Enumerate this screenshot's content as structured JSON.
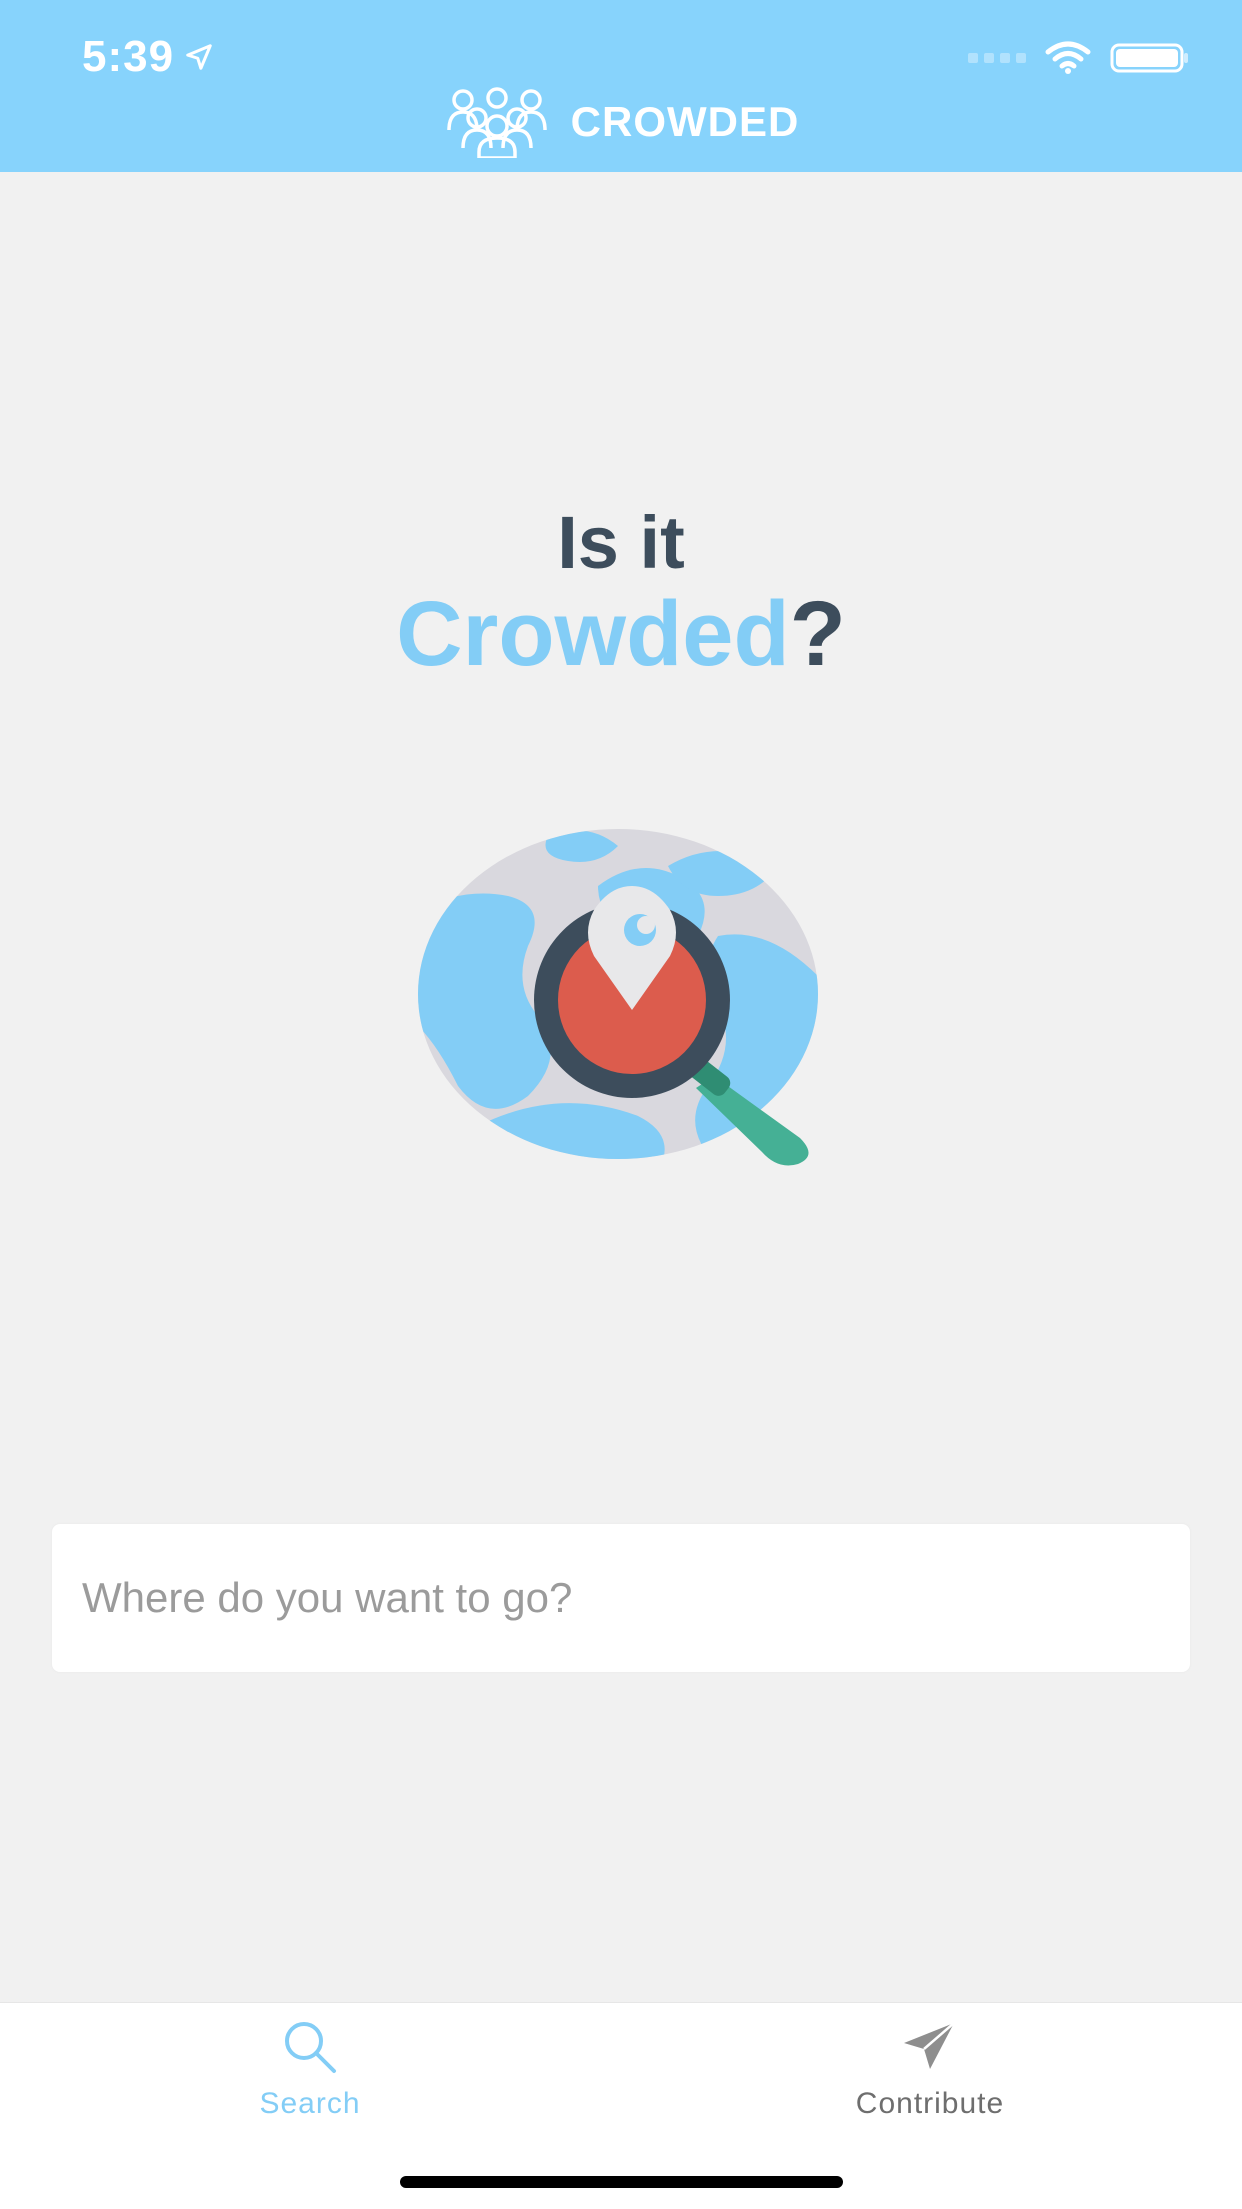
{
  "status_bar": {
    "time": "5:39"
  },
  "header": {
    "brand_name": "CROWDED"
  },
  "headline": {
    "line1": "Is it",
    "accent": "Crowded",
    "question_mark": "?"
  },
  "search": {
    "placeholder": "Where do you want to go?"
  },
  "tabs": [
    {
      "label": "Search",
      "icon": "search-icon",
      "active": true
    },
    {
      "label": "Contribute",
      "icon": "paper-plane-icon",
      "active": false
    }
  ],
  "colors": {
    "header_bg": "#87d3fc",
    "accent": "#83cdf6",
    "dark_text": "#3d4d5c",
    "background": "#f1f1f1"
  }
}
